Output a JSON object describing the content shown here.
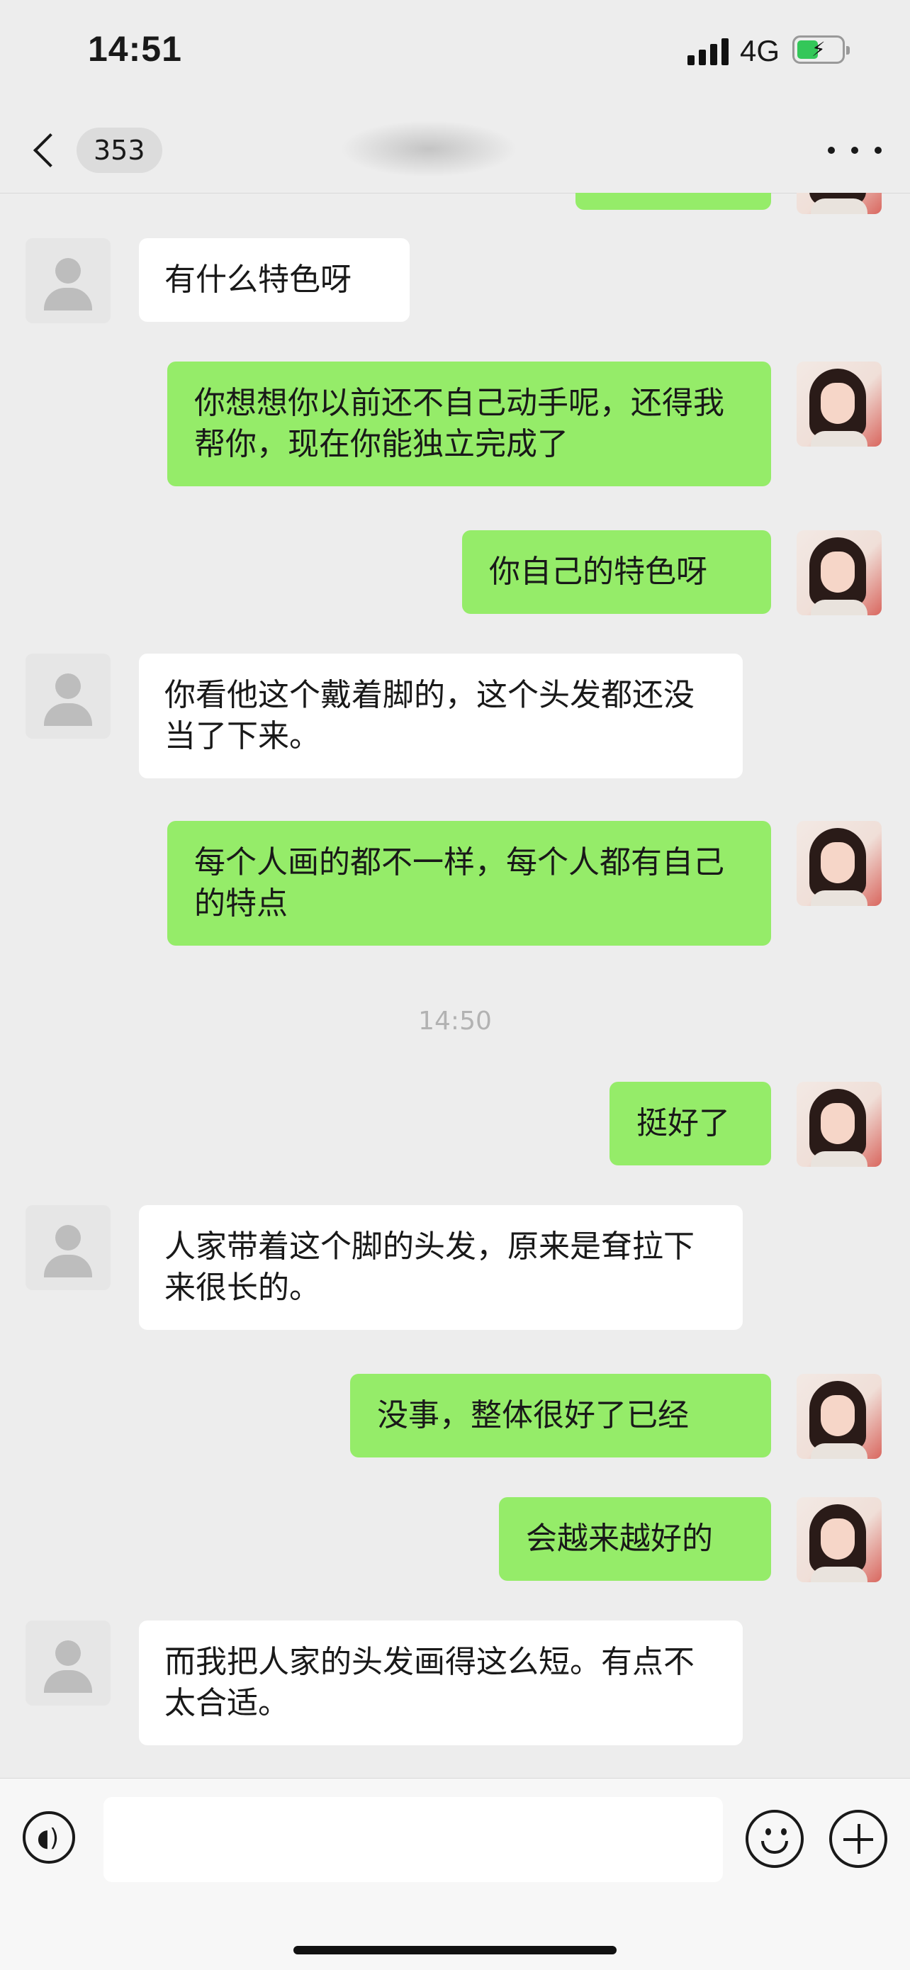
{
  "status_bar": {
    "time": "14:51",
    "network": "4G",
    "battery_level": 0.42
  },
  "nav": {
    "unread_count": "353"
  },
  "timestamp": "14:50",
  "messages": [
    {
      "side": "incoming",
      "text": "有什么特色呀"
    },
    {
      "side": "outgoing",
      "text": "你想想你以前还不自己动手呢，还得我帮你，现在你能独立完成了"
    },
    {
      "side": "outgoing",
      "text": "你自己的特色呀"
    },
    {
      "side": "incoming",
      "text": "你看他这个戴着脚的，这个头发都还没当了下来。"
    },
    {
      "side": "outgoing",
      "text": "每个人画的都不一样，每个人都有自己的特点"
    },
    {
      "side": "outgoing",
      "text": "挺好了"
    },
    {
      "side": "incoming",
      "text": "人家带着这个脚的头发，原来是耷拉下来很长的。"
    },
    {
      "side": "outgoing",
      "text": "没事，整体很好了已经"
    },
    {
      "side": "outgoing",
      "text": "会越来越好的"
    },
    {
      "side": "incoming",
      "text": "而我把人家的头发画得这么短。有点不太合适。"
    }
  ],
  "colors": {
    "background": "#ededed",
    "incoming_bubble": "#ffffff",
    "outgoing_bubble": "#95ec69",
    "time_label": "#b2b2b2"
  },
  "icons": {
    "back": "chevron-left-icon",
    "more": "more-dots-icon",
    "voice": "voice-icon",
    "emoji": "emoji-icon",
    "plus": "plus-icon"
  }
}
